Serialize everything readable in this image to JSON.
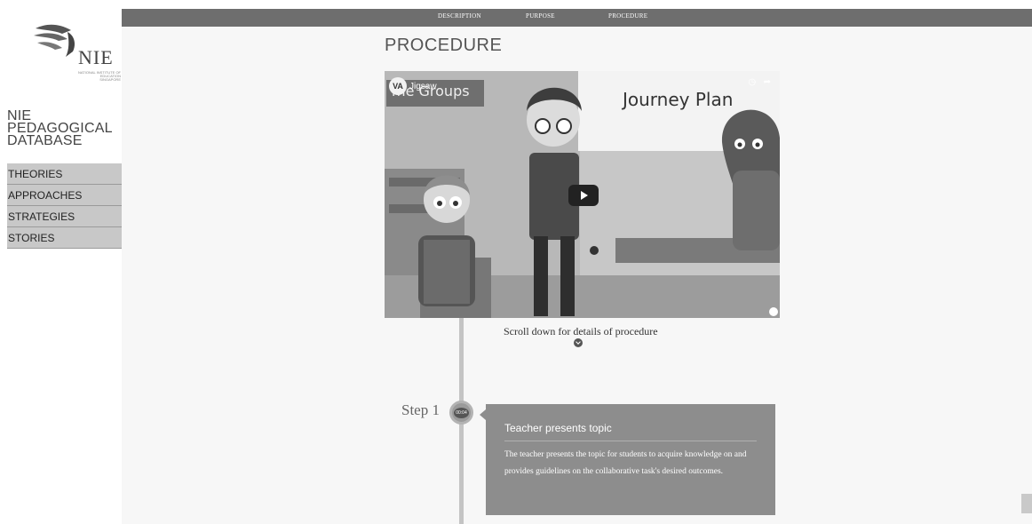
{
  "sidebar": {
    "logo_text": "NIE",
    "logo_subtext": "NATIONAL INSTITUTE OF EDUCATION SINGAPORE",
    "title_lines": [
      "NIE",
      "PEDAGOGICAL",
      "DATABASE"
    ],
    "menu": [
      "THEORIES",
      "APPROACHES",
      "STRATEGIES",
      "STORIES"
    ]
  },
  "topnav": {
    "links": [
      "DESCRIPTION",
      "PURPOSE",
      "PROCEDURE"
    ]
  },
  "main": {
    "page_title": "PROCEDURE",
    "video": {
      "channel_title": "Jigsaw",
      "board_text": "Journey Plan",
      "groups_text": "me Groups"
    },
    "scroll_hint": "Scroll down for details of procedure",
    "step": {
      "label": "Step 1",
      "time": "00:04",
      "title": "Teacher presents topic",
      "body": "The teacher presents the topic for students to acquire knowledge on and provides guidelines on the collaborative task's desired outcomes."
    }
  }
}
